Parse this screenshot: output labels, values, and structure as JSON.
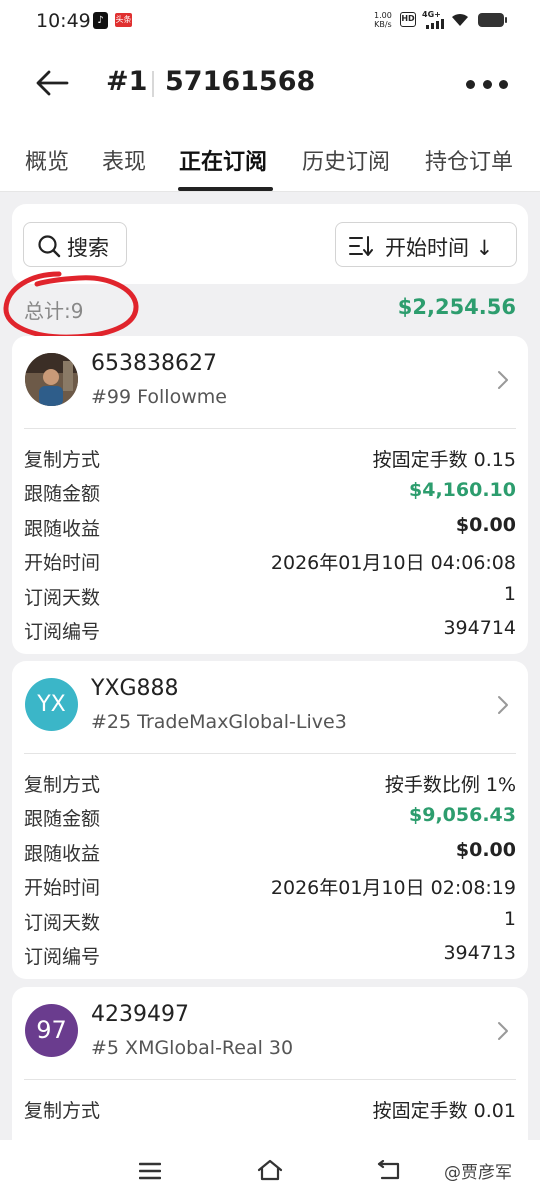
{
  "status_bar": {
    "time": "10:49",
    "app_icon_2_text": "头条",
    "net_speed_value": "1.00",
    "net_speed_unit": "KB/s",
    "hd": "HD",
    "network": "4G+"
  },
  "header": {
    "account_number": "#1",
    "account_id": "57161568"
  },
  "tabs": [
    {
      "label": "概览"
    },
    {
      "label": "表现"
    },
    {
      "label": "正在订阅"
    },
    {
      "label": "历史订阅"
    },
    {
      "label": "持仓订单"
    }
  ],
  "toolbar": {
    "search_label": "搜索",
    "sort_label": "开始时间"
  },
  "summary": {
    "total_count": "总计:9",
    "total_amount": "$2,254.56"
  },
  "subscriptions": [
    {
      "trader_id": "653838627",
      "server": "#99 Followme",
      "avatar_text": "",
      "copy_mode_label": "复制方式",
      "copy_mode": "按固定手数 0.15",
      "follow_amount_label": "跟随金额",
      "follow_amount": "$4,160.10",
      "follow_profit_label": "跟随收益",
      "follow_profit": "$0.00",
      "start_time_label": "开始时间",
      "start_time": "2026年01月10日 04:06:08",
      "days_label": "订阅天数",
      "days": "1",
      "sub_no_label": "订阅编号",
      "sub_no": "394714"
    },
    {
      "trader_id": "YXG888",
      "server": "#25 TradeMaxGlobal-Live3",
      "avatar_text": "YX",
      "copy_mode_label": "复制方式",
      "copy_mode": "按手数比例 1%",
      "follow_amount_label": "跟随金额",
      "follow_amount": "$9,056.43",
      "follow_profit_label": "跟随收益",
      "follow_profit": "$0.00",
      "start_time_label": "开始时间",
      "start_time": "2026年01月10日 02:08:19",
      "days_label": "订阅天数",
      "days": "1",
      "sub_no_label": "订阅编号",
      "sub_no": "394713"
    },
    {
      "trader_id": "4239497",
      "server": "#5 XMGlobal-Real 30",
      "avatar_text": "97",
      "copy_mode_label": "复制方式",
      "copy_mode": "按固定手数 0.01"
    }
  ],
  "watermark": "@贾彦军",
  "colors": {
    "accent_green": "#2d9d6e",
    "annotation_red": "#e0242c",
    "avatar_teal": "#3bb6c8",
    "avatar_purple": "#6a3c8e"
  }
}
